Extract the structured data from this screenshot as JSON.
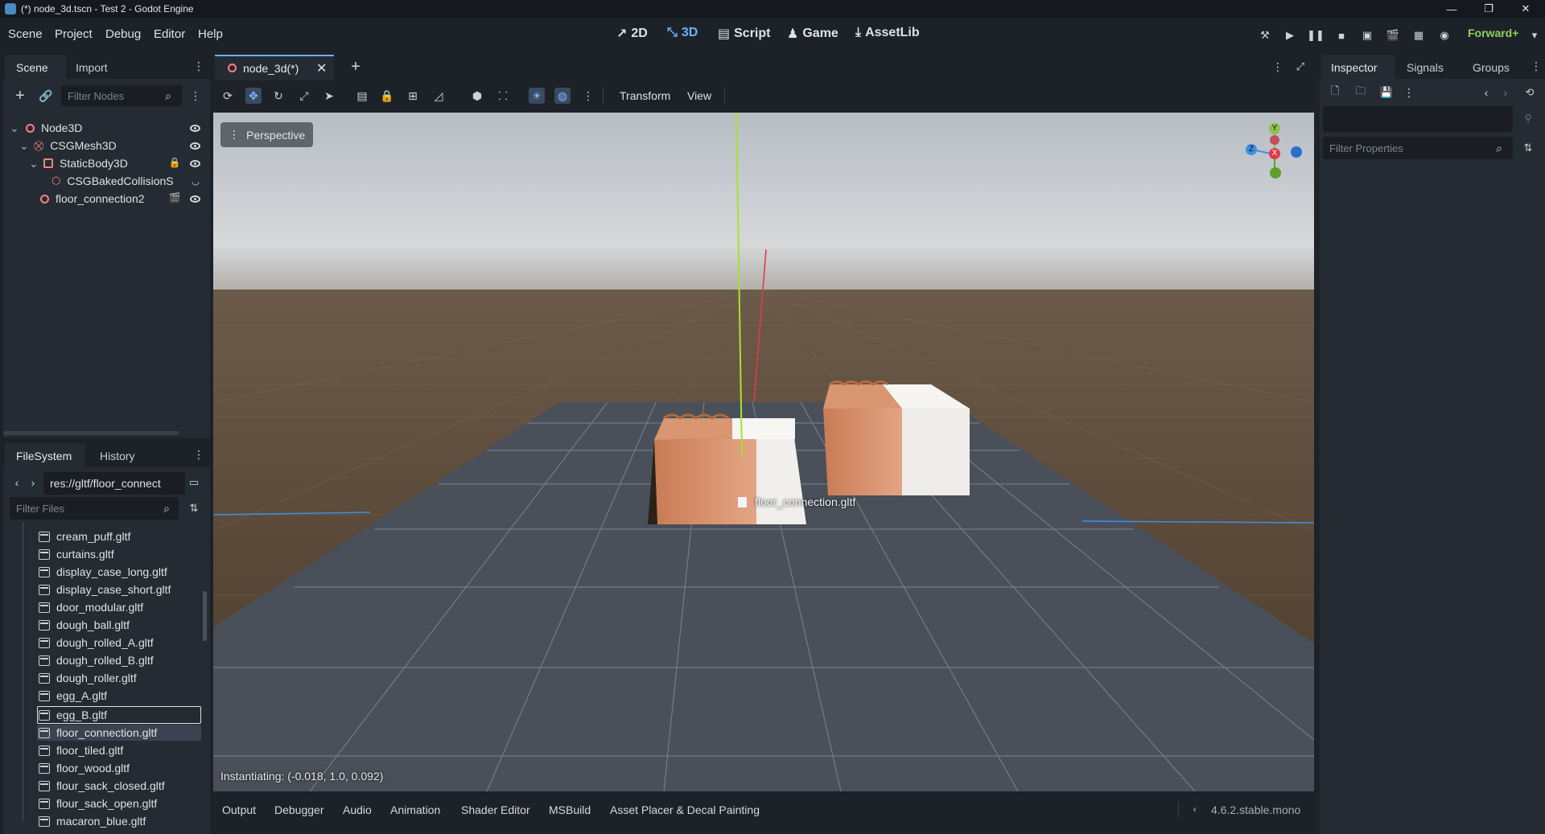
{
  "window": {
    "title": "(*) node_3d.tscn - Test 2 - Godot Engine",
    "controls": [
      "—",
      "❐",
      "✕"
    ]
  },
  "menu": {
    "items": [
      "Scene",
      "Project",
      "Debug",
      "Editor",
      "Help"
    ]
  },
  "workspaces": {
    "items": [
      {
        "label": "2D",
        "icon": "2d-icon"
      },
      {
        "label": "3D",
        "icon": "3d-icon"
      },
      {
        "label": "Script",
        "icon": "script-icon"
      },
      {
        "label": "Game",
        "icon": "game-icon"
      },
      {
        "label": "AssetLib",
        "icon": "assetlib-icon"
      }
    ],
    "active": "3D"
  },
  "renderer": {
    "label": "Forward+"
  },
  "scene_dock": {
    "tabs": [
      "Scene",
      "Import"
    ],
    "filter_placeholder": "Filter Nodes",
    "tree": [
      {
        "label": "Node3D",
        "depth": 0,
        "icon": "node3d-icon"
      },
      {
        "label": "CSGMesh3D",
        "depth": 1,
        "icon": "csgmesh-icon"
      },
      {
        "label": "StaticBody3D",
        "depth": 2,
        "icon": "staticbody-icon"
      },
      {
        "label": "CSGBakedCollisionS",
        "depth": 3,
        "icon": "collision-shape-icon"
      },
      {
        "label": "floor_connection2",
        "depth": 2,
        "icon": "node3d-icon"
      }
    ]
  },
  "filesystem_dock": {
    "tabs": [
      "FileSystem",
      "History"
    ],
    "path": "res://gltf/floor_connect",
    "filter_placeholder": "Filter Files",
    "files": [
      "cream_puff.gltf",
      "curtains.gltf",
      "display_case_long.gltf",
      "display_case_short.gltf",
      "door_modular.gltf",
      "dough_ball.gltf",
      "dough_rolled_A.gltf",
      "dough_rolled_B.gltf",
      "dough_roller.gltf",
      "egg_A.gltf",
      "egg_B.gltf",
      "floor_connection.gltf",
      "floor_tiled.gltf",
      "floor_wood.gltf",
      "flour_sack_closed.gltf",
      "flour_sack_open.gltf",
      "macaron_blue.gltf"
    ],
    "hovered": "egg_B.gltf",
    "selected": "floor_connection.gltf"
  },
  "editor_tabs": {
    "items": [
      {
        "label": "node_3d(*)"
      }
    ]
  },
  "viewport_toolbar": {
    "menus": [
      "Transform",
      "View"
    ]
  },
  "viewport": {
    "perspective_label": "Perspective",
    "drag_label": "floor_connection.gltf",
    "status": "Instantiating: (-0.018, 1.0, 0.092)",
    "gizmo": {
      "y": "Y",
      "x": "X",
      "z": "Z"
    }
  },
  "bottom_panel": {
    "tabs": [
      "Output",
      "Debugger",
      "Audio",
      "Animation",
      "Shader Editor",
      "MSBuild",
      "Asset Placer & Decal Painting"
    ],
    "version": "4.6.2.stable.mono"
  },
  "inspector": {
    "tabs": [
      "Inspector",
      "Signals",
      "Groups"
    ],
    "filter_placeholder": "Filter Properties"
  },
  "colors": {
    "accent": "#6fb0ff",
    "renderer": "#8fd35a",
    "node_red": "#fc7f7f"
  }
}
